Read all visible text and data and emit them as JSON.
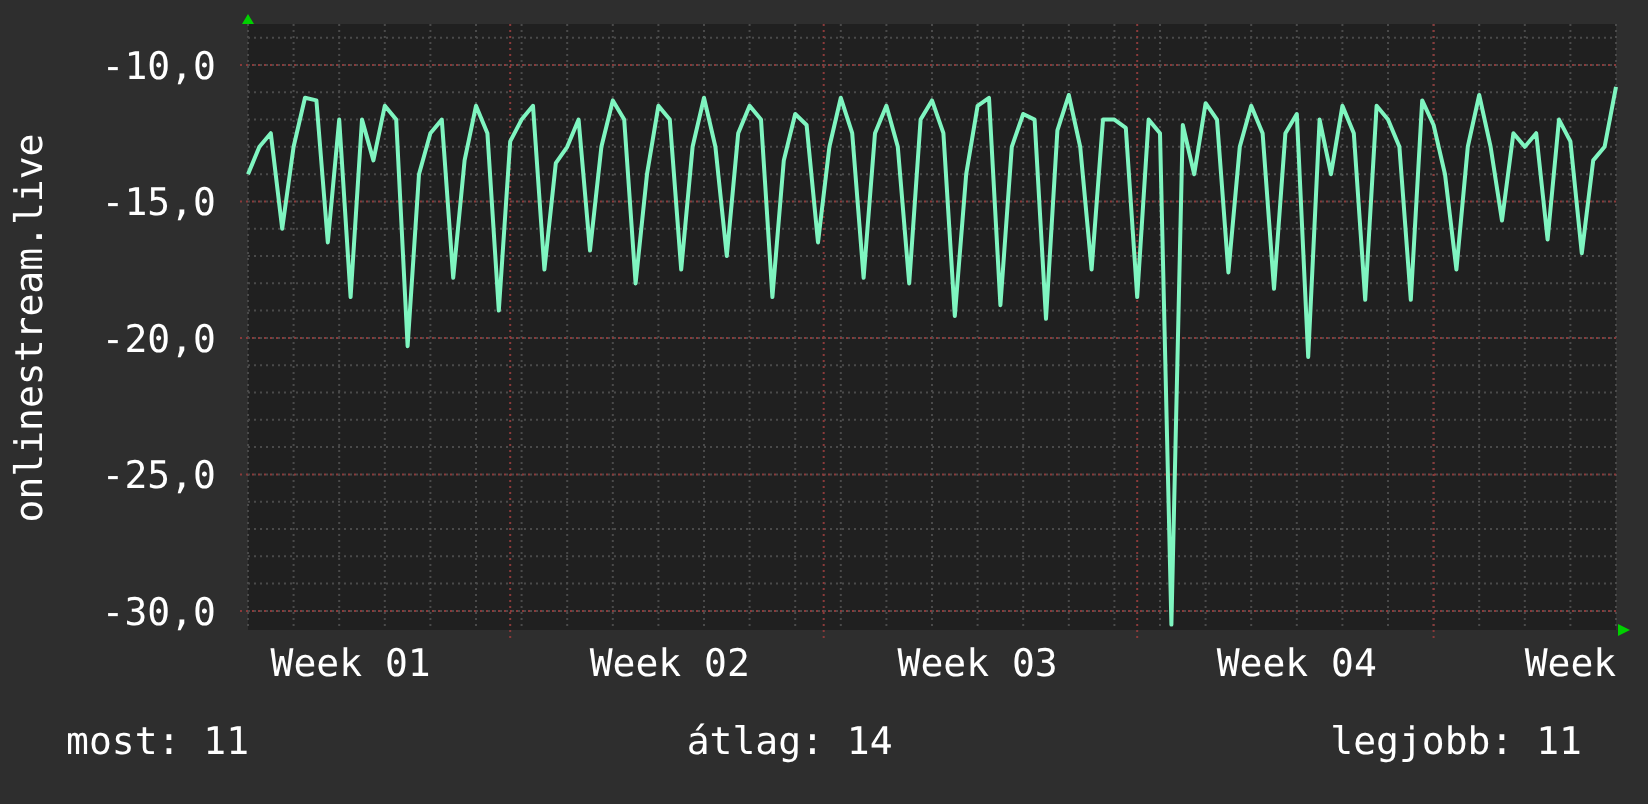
{
  "chart": {
    "chart_data": {
      "type": "line",
      "ylabel": "onlinestream.live",
      "categories": [
        null,
        null,
        null,
        null,
        null,
        null,
        null,
        null,
        null,
        "Week 01",
        null,
        null,
        null,
        null,
        null,
        null,
        null,
        null,
        null,
        null,
        null,
        null,
        null,
        null,
        null,
        null,
        null,
        null,
        null,
        null,
        null,
        null,
        null,
        null,
        null,
        null,
        null,
        "Week 02",
        null,
        null,
        null,
        null,
        null,
        null,
        null,
        null,
        null,
        null,
        null,
        null,
        null,
        null,
        null,
        null,
        null,
        null,
        null,
        null,
        null,
        null,
        null,
        null,
        null,
        null,
        "Week 03",
        null,
        null,
        null,
        null,
        null,
        null,
        null,
        null,
        null,
        null,
        null,
        null,
        null,
        null,
        null,
        null,
        null,
        null,
        null,
        null,
        null,
        null,
        null,
        null,
        null,
        null,
        null,
        "Week 04",
        null,
        null,
        null,
        null,
        null,
        null,
        null,
        null,
        null,
        null,
        null,
        null,
        null,
        null,
        null,
        null,
        null,
        null,
        null,
        null,
        null,
        null,
        null,
        "Week",
        null,
        null,
        null,
        null
      ],
      "series": [
        {
          "color": "#7ff5c0",
          "values": [
            -14,
            -13,
            -12.5,
            -16,
            -13,
            -11.2,
            -11.3,
            -16.5,
            -12,
            -18.5,
            -12,
            -13.5,
            -11.5,
            -12,
            -20.3,
            -14,
            -12.5,
            -12,
            -17.8,
            -13.5,
            -11.5,
            -12.5,
            -19,
            -12.8,
            -12,
            -11.5,
            -17.5,
            -13.6,
            -13,
            -12,
            -16.8,
            -13,
            -11.3,
            -12,
            -18,
            -14,
            -11.5,
            -12,
            -17.5,
            -13,
            -11.2,
            -13,
            -17,
            -12.5,
            -11.5,
            -12,
            -18.5,
            -13.5,
            -11.8,
            -12.2,
            -16.5,
            -13,
            -11.2,
            -12.5,
            -17.8,
            -12.5,
            -11.5,
            -13,
            -18,
            -12,
            -11.3,
            -12.5,
            -19.2,
            -14,
            -11.5,
            -11.2,
            -18.8,
            -13,
            -11.8,
            -12,
            -19.3,
            -12.4,
            -11.1,
            -13,
            -17.5,
            -12,
            -12,
            -12.3,
            -18.5,
            -12,
            -12.5,
            -30.5,
            -12.2,
            -14,
            -11.4,
            -12,
            -17.6,
            -13,
            -11.5,
            -12.5,
            -18.2,
            -12.5,
            -11.8,
            -20.7,
            -12,
            -14,
            -11.5,
            -12.5,
            -18.6,
            -11.5,
            -12,
            -13,
            -18.6,
            -11.3,
            -12.2,
            -14,
            -17.5,
            -13,
            -11.1,
            -13,
            -15.7,
            -12.5,
            -13,
            -12.5,
            -16.4,
            -12,
            -12.8,
            -16.9,
            -13.5,
            -13,
            -10.8
          ]
        }
      ],
      "grid": true,
      "ylim": [
        -30.7,
        -8.5
      ],
      "yticks": [
        {
          "value": -10,
          "label": "-10,0"
        },
        {
          "value": -15,
          "label": "-15,0"
        },
        {
          "value": -20,
          "label": "-20,0"
        },
        {
          "value": -25,
          "label": "-25,0"
        },
        {
          "value": -30,
          "label": "-30,0"
        }
      ]
    }
  },
  "stats": [
    {
      "text": "most: 11"
    },
    {
      "text": "átlag: 14"
    },
    {
      "text": "legjobb: 11"
    }
  ]
}
